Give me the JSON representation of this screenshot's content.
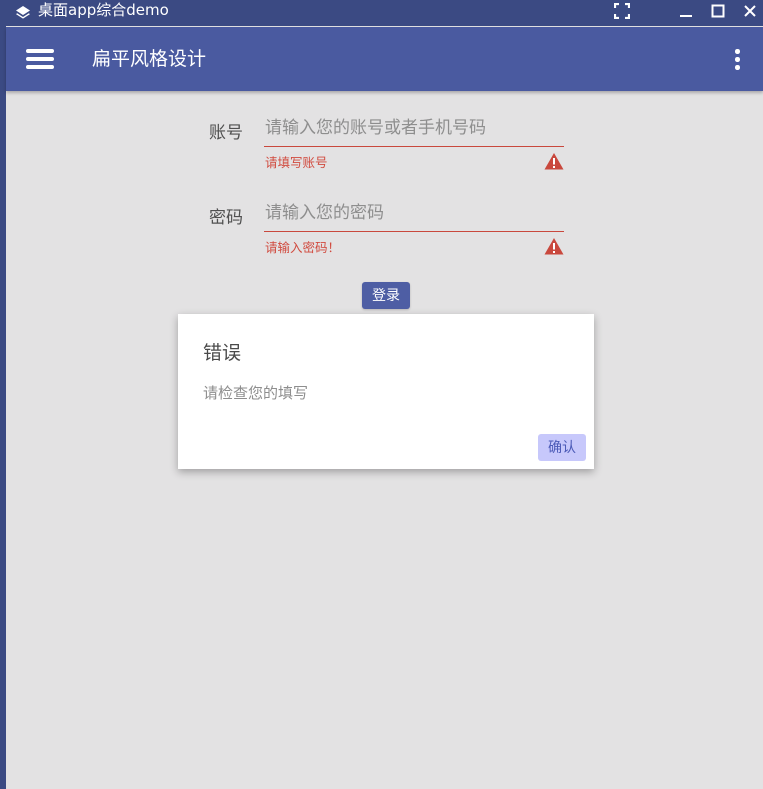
{
  "window": {
    "title": "桌面app综合demo",
    "icons": {
      "app": "layers-icon",
      "fullscreen": "fullscreen-icon",
      "minimize": "minimize-icon",
      "maximize": "maximize-icon",
      "close": "close-icon"
    }
  },
  "appbar": {
    "title": "扁平风格设计",
    "menu_icon": "hamburger-menu-icon",
    "more_icon": "more-vert-icon"
  },
  "form": {
    "account": {
      "label": "账号",
      "placeholder": "请输入您的账号或者手机号码",
      "value": "",
      "error": "请填写账号"
    },
    "password": {
      "label": "密码",
      "placeholder": "请输入您的密码",
      "value": "",
      "error": "请输入密码！"
    },
    "login_label": "登录"
  },
  "dialog": {
    "title": "错误",
    "message": "请检查您的填写",
    "confirm_label": "确认"
  },
  "colors": {
    "titlebar": "#3b4a83",
    "appbar": "#4a5aa0",
    "background": "#e3e2e3",
    "error": "#c9483d",
    "primary_button": "#4e5ea4",
    "dialog_button_bg": "#c7c8fb",
    "dialog_button_text": "#4b5ab7"
  }
}
